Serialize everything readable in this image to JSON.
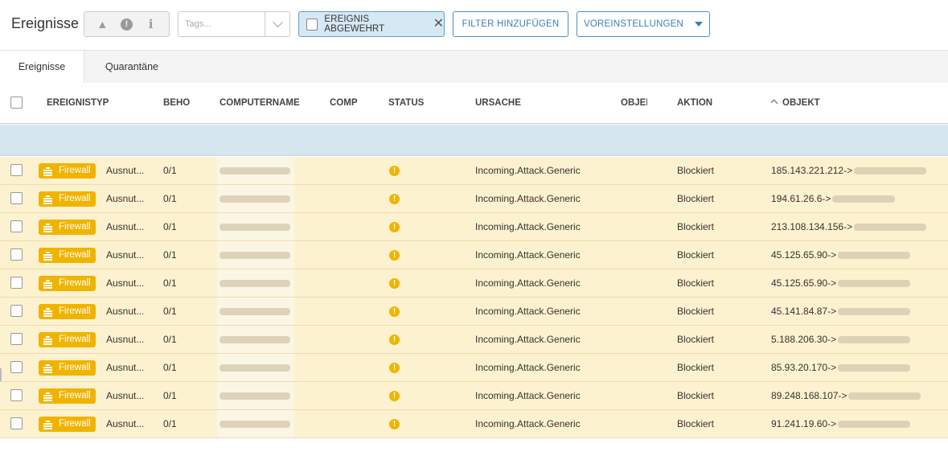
{
  "header": {
    "title": "Ereignisse",
    "tags_placeholder": "Tags...",
    "filter_chip_label": "EREIGNIS ABGEWEHRT",
    "add_filter_label": "FILTER HINZUFÜGEN",
    "presets_label": "VOREINSTELLUNGEN",
    "severity_icons": [
      "warning-triangle-icon",
      "exclamation-circle-icon",
      "info-icon"
    ]
  },
  "tabs": [
    {
      "label": "Ereignisse",
      "active": true
    },
    {
      "label": "Quarantäne",
      "active": false
    }
  ],
  "columns": {
    "ereignistyp": "EREIGNISTYP",
    "beho": "BEHO",
    "computername": "COMPUTERNAME",
    "comp": "COMP",
    "status": "STATUS",
    "ursache": "URSACHE",
    "objei": "OBJEI",
    "aktion": "AKTION",
    "objekt": "OBJEKT"
  },
  "sort": {
    "column": "OBJEKT",
    "direction": "ascending"
  },
  "colors": {
    "row_background": "#fdf2cf",
    "badge": "#f0b400",
    "filter_row": "#d6e6ee",
    "accent": "#3b7fb6"
  },
  "rows": [
    {
      "type": "Firewall",
      "detail": "Ausnut...",
      "beho": "0/1",
      "ursache": "Incoming.Attack.Generic",
      "aktion": "Blockiert",
      "objekt": "185.143.221.212->"
    },
    {
      "type": "Firewall",
      "detail": "Ausnut...",
      "beho": "0/1",
      "ursache": "Incoming.Attack.Generic",
      "aktion": "Blockiert",
      "objekt": "194.61.26.6->"
    },
    {
      "type": "Firewall",
      "detail": "Ausnut...",
      "beho": "0/1",
      "ursache": "Incoming.Attack.Generic",
      "aktion": "Blockiert",
      "objekt": "213.108.134.156->"
    },
    {
      "type": "Firewall",
      "detail": "Ausnut...",
      "beho": "0/1",
      "ursache": "Incoming.Attack.Generic",
      "aktion": "Blockiert",
      "objekt": "45.125.65.90->"
    },
    {
      "type": "Firewall",
      "detail": "Ausnut...",
      "beho": "0/1",
      "ursache": "Incoming.Attack.Generic",
      "aktion": "Blockiert",
      "objekt": "45.125.65.90->"
    },
    {
      "type": "Firewall",
      "detail": "Ausnut...",
      "beho": "0/1",
      "ursache": "Incoming.Attack.Generic",
      "aktion": "Blockiert",
      "objekt": "45.141.84.87->"
    },
    {
      "type": "Firewall",
      "detail": "Ausnut...",
      "beho": "0/1",
      "ursache": "Incoming.Attack.Generic",
      "aktion": "Blockiert",
      "objekt": "5.188.206.30->"
    },
    {
      "type": "Firewall",
      "detail": "Ausnut...",
      "beho": "0/1",
      "ursache": "Incoming.Attack.Generic",
      "aktion": "Blockiert",
      "objekt": "85.93.20.170->"
    },
    {
      "type": "Firewall",
      "detail": "Ausnut...",
      "beho": "0/1",
      "ursache": "Incoming.Attack.Generic",
      "aktion": "Blockiert",
      "objekt": "89.248.168.107->"
    },
    {
      "type": "Firewall",
      "detail": "Ausnut...",
      "beho": "0/1",
      "ursache": "Incoming.Attack.Generic",
      "aktion": "Blockiert",
      "objekt": "91.241.19.60->"
    }
  ]
}
